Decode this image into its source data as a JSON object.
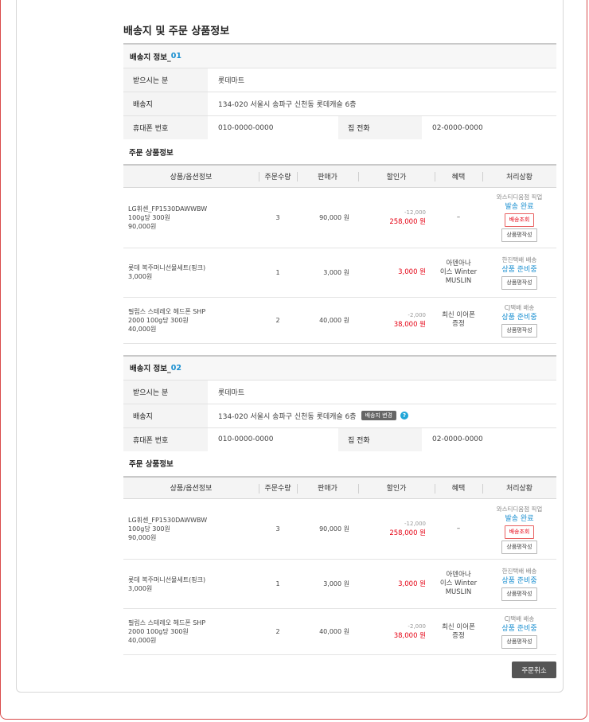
{
  "page": {
    "title": "배송지 및 주문 상품정보"
  },
  "labels": {
    "recipient": "받으시는 분",
    "address": "배송지",
    "mobile": "휴대폰 번호",
    "home_phone": "집 전화",
    "order_products": "주문 상품정보",
    "change_address": "배송지 변경",
    "help": "?"
  },
  "columns": [
    "상품/옵션정보",
    "주문수량",
    "판매가",
    "할인가",
    "혜택",
    "처리상황"
  ],
  "shipments": [
    {
      "head_label": "배송지 정보_",
      "head_num": "01",
      "recipient": "롯데마트",
      "address": "134-020  서울시 송파구 신천동 롯데캐슬 6층",
      "mobile": "010-0000-0000",
      "home_phone": "02-0000-0000",
      "items": [
        {
          "name_lines": [
            "LG휘센_FP1530DAWWBW",
            "100g당 300원",
            "90,000원"
          ],
          "qty": "3",
          "price": "90,000 원",
          "disc_orig": "-12,000",
          "disc_final": "258,000 원",
          "benefit": "–",
          "carrier": "와스티디움점 픽업",
          "status": "발송 완료",
          "buttons": [
            "배송조회",
            "상품평작성"
          ]
        },
        {
          "name_lines": [
            "롯데 복주머니선물세트(핑크)",
            "3,000원"
          ],
          "qty": "1",
          "price": "3,000 원",
          "disc_orig": "",
          "disc_final": "3,000 원",
          "benefit": "아덴아나\n이스 Winter\nMUSLIN",
          "carrier": "한진택배 배송",
          "status": "상품 준비중",
          "buttons": [
            "상품평작성"
          ]
        },
        {
          "name_lines": [
            "필립스 스테레오 헤드폰 SHP",
            "2000 100g당 300원",
            "40,000원"
          ],
          "qty": "2",
          "price": "40,000 원",
          "disc_orig": "-2,000",
          "disc_final": "38,000 원",
          "benefit": "최신 이어폰\n증정",
          "carrier": "CJ택배 배송",
          "status": "상품 준비중",
          "buttons": [
            "상품평작성"
          ]
        }
      ]
    },
    {
      "head_label": "배송지 정보_",
      "head_num": "02",
      "recipient": "롯데마트",
      "address": "134-020  서울시 송파구 신천동 롯데캐슬 6층",
      "mobile": "010-0000-0000",
      "home_phone": "02-0000-0000",
      "items": [
        {
          "name_lines": [
            "LG휘센_FP1530DAWWBW",
            "100g당 300원",
            "90,000원"
          ],
          "qty": "3",
          "price": "90,000 원",
          "disc_orig": "-12,000",
          "disc_final": "258,000 원",
          "benefit": "–",
          "carrier": "와스티디움점 픽업",
          "status": "발송 완료",
          "buttons": [
            "배송조회",
            "상품평작성"
          ]
        },
        {
          "name_lines": [
            "롯데 복주머니선물세트(핑크)",
            "3,000원"
          ],
          "qty": "1",
          "price": "3,000 원",
          "disc_orig": "",
          "disc_final": "3,000 원",
          "benefit": "아덴아나\n이스 Winter\nMUSLIN",
          "carrier": "한진택배 배송",
          "status": "상품 준비중",
          "buttons": [
            "상품평작성"
          ]
        },
        {
          "name_lines": [
            "필립스 스테레오 헤드폰 SHP",
            "2000 100g당 300원",
            "40,000원"
          ],
          "qty": "2",
          "price": "40,000 원",
          "disc_orig": "-2,000",
          "disc_final": "38,000 원",
          "benefit": "최신 이어폰\n증정",
          "carrier": "CJ택배 배송",
          "status": "상품 준비중",
          "buttons": [
            "상품평작성"
          ]
        }
      ]
    }
  ],
  "footer": {
    "cancel_order": "주문취소"
  }
}
